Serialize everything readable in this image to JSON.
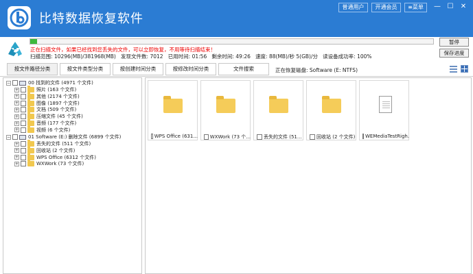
{
  "app": {
    "title": "比特数据恢复软件",
    "buttons": {
      "vip_user": "普通用户",
      "open_vip": "开通会员",
      "menu": "菜单"
    },
    "window_controls": {
      "minimize": "—",
      "maximize": "☐",
      "close": "✕"
    }
  },
  "scan": {
    "progress_fraction": 0.017,
    "status_message": "正在扫描文件，如果已经找到您丢失的文件，可以立即恢复，不用等待扫描结束！",
    "range": "扫描范围: 10296(MB)/381968(MB)",
    "files_found": "发现文件数: 7012",
    "elapsed": "已用时间: 01:56",
    "remaining": "剩余时间: 49:26",
    "speed": "速度: 88(MB)/秒  5(GB)/分",
    "success_rate": "读设备成功率: 100%",
    "pause_button": "暂停",
    "save_progress_button": "保存进度"
  },
  "tabs": [
    {
      "label": "按文件路径分类",
      "active": true
    },
    {
      "label": "按文件类型分类",
      "active": false
    },
    {
      "label": "按创建时间分类",
      "active": false
    },
    {
      "label": "按修改时间分类",
      "active": false
    },
    {
      "label": "文件搜索",
      "active": false
    }
  ],
  "disk_status": "正在恢复磁盘: Software (E: NTFS)",
  "tree": {
    "group0": {
      "expander": "−",
      "label": "00 找到的文件  (4971 个文件)"
    },
    "group0_items": [
      {
        "expander": "+",
        "label": "照片     (163 个文件)"
      },
      {
        "expander": "+",
        "label": "其他     (2174 个文件)"
      },
      {
        "expander": "+",
        "label": "图像     (1897 个文件)"
      },
      {
        "expander": "+",
        "label": "文档     (509 个文件)"
      },
      {
        "expander": "+",
        "label": "压缩文件     (45 个文件)"
      },
      {
        "expander": "+",
        "label": "音频     (177 个文件)"
      },
      {
        "expander": "+",
        "label": "视频     (6 个文件)"
      }
    ],
    "group1": {
      "expander": "−",
      "label": "01 Software (E:) 删除文件  (6899 个文件)"
    },
    "group1_items": [
      {
        "expander": "+",
        "label": "丢失的文件     (511 个文件)"
      },
      {
        "expander": "+",
        "label": "回收站     (2 个文件)"
      },
      {
        "expander": "+",
        "label": "WPS Office     (6312 个文件)"
      },
      {
        "expander": "+",
        "label": "WXWork     (73 个文件)"
      }
    ]
  },
  "grid": [
    {
      "type": "folder",
      "label": "WPS Office  (631..."
    },
    {
      "type": "folder",
      "label": "WXWork  (73 个..."
    },
    {
      "type": "folder",
      "label": "丢失的文件  (51..."
    },
    {
      "type": "folder",
      "label": "回收站  (2 个文件)"
    },
    {
      "type": "file",
      "label": "WEMediaTestRigh..."
    }
  ],
  "colors": {
    "titlebar": "#2b7cd3",
    "progress": "#3db93d",
    "status_red": "#e00000",
    "folder": "#f5cc59"
  },
  "icons": {
    "logo": "bit-logo-icon",
    "recycle": "recycle-icon",
    "list_view": "list-view-icon",
    "grid_view": "grid-view-icon"
  }
}
